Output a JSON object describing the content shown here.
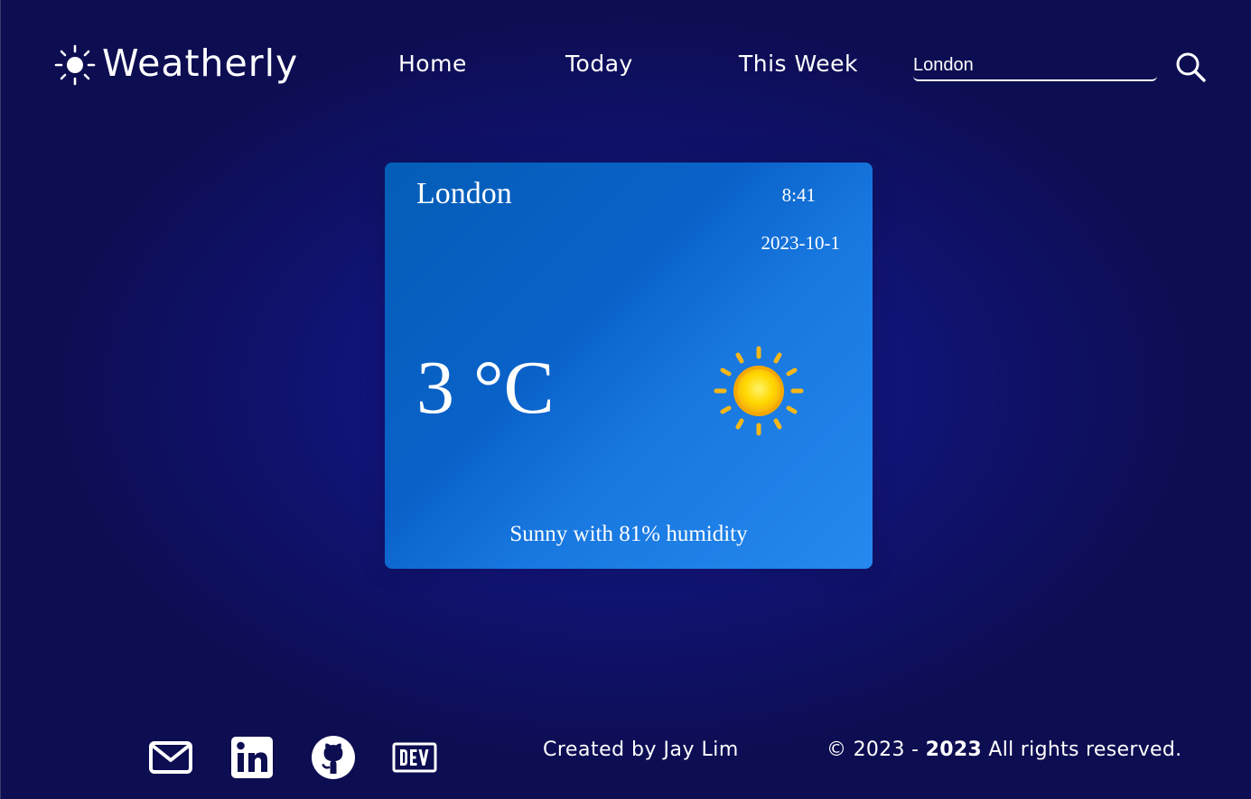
{
  "brand": {
    "name": "Weatherly",
    "icon": "sun-icon"
  },
  "nav": {
    "items": [
      {
        "label": "Home"
      },
      {
        "label": "Today"
      },
      {
        "label": "This Week"
      }
    ]
  },
  "search": {
    "value": "London",
    "placeholder": "",
    "icon": "search-icon"
  },
  "weather_card": {
    "city": "London",
    "time": "8:41",
    "date": "2023-10-1",
    "temperature": "3 °C",
    "condition_icon": "sun-icon",
    "description": "Sunny with 81% humidity"
  },
  "footer": {
    "social": [
      {
        "name": "mail-icon"
      },
      {
        "name": "linkedin-icon"
      },
      {
        "name": "github-icon"
      },
      {
        "name": "dev-icon"
      }
    ],
    "credit": "Created by Jay Lim",
    "copyright_prefix": "© 2023 - ",
    "copyright_year": "2023",
    "copyright_suffix": " All rights reserved."
  },
  "colors": {
    "background": "#0d0d52",
    "background_glow": "#151a8e",
    "card_start": "#045db6",
    "card_end": "#2589ef",
    "sun_core": "#ffd800",
    "sun_rays": "#f7b718",
    "text": "#ffffff"
  }
}
